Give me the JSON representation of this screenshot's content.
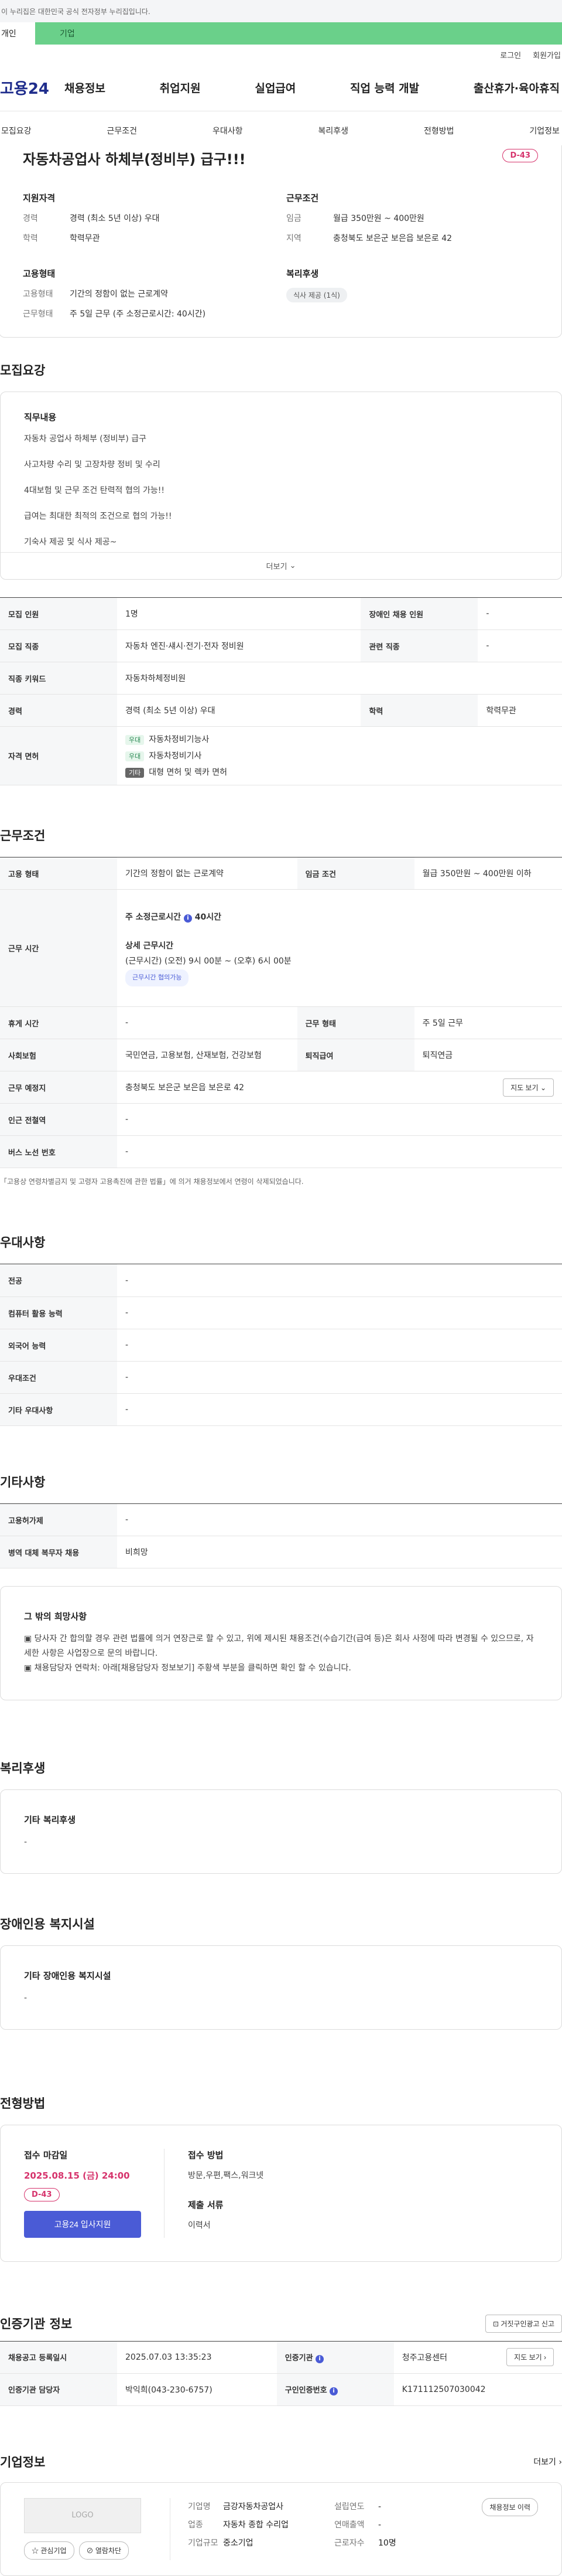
{
  "gov_banner": "이 누리집은 대한민국 공식 전자정부 누리집입니다.",
  "user_tabs": [
    "개인",
    "기업"
  ],
  "util_links": [
    "로그인",
    "회원가입"
  ],
  "logo": "고용24",
  "gnb": [
    "채용정보",
    "취업지원",
    "실업급여",
    "직업 능력 개발",
    "출산휴가·육아휴직"
  ],
  "subtabs": [
    "모집요강",
    "근무조건",
    "우대사항",
    "복리후생",
    "전형방법",
    "기업정보"
  ],
  "job": {
    "title": "자동차공업사 하체부(정비부) 급구!!!",
    "dday": "D-43",
    "qual_title": "지원자격",
    "qual": [
      [
        "경력",
        "경력 (최소 5년 이상) 우대"
      ],
      [
        "학력",
        "학력무관"
      ]
    ],
    "cond_title": "근무조건",
    "cond": [
      [
        "임금",
        "월급 350만원 ~ 400만원"
      ],
      [
        "지역",
        "충청북도 보은군 보은읍 보은로 42"
      ]
    ],
    "emp_title": "고용형태",
    "emp": [
      [
        "고용형태",
        "기간의 정함이 없는 근로계약"
      ],
      [
        "근무형태",
        "주 5일 근무 (주 소정근로시간: 40시간)"
      ]
    ],
    "welfare_title": "복리후생",
    "welfare_chip": "식사 제공 (1식)"
  },
  "recruit": {
    "title": "모집요강",
    "duty_title": "직무내용",
    "lines": [
      "자동차 공업사 하체부 (정비부) 급구",
      "사고차량 수리 및 고장차량 정비 및 수리",
      "4대보험 및 근무 조건 탄력적 협의 가능!!",
      "급여는 최대한 최적의 조건으로 협의 가능!!",
      "기숙사 제공 및 식사 제공~"
    ],
    "more": "더보기"
  },
  "recruit_table": {
    "headcount_k": "모집 인원",
    "headcount_v": "1명",
    "disabled_k": "장애인 채용 인원",
    "disabled_v": "-",
    "job_k": "모집 직종",
    "job_v": "자동차 엔진·섀시·전기·전자 정비원",
    "related_k": "관련 직종",
    "related_v": "-",
    "kw_k": "직종 키워드",
    "kw_v": "자동차하체정비원",
    "career_k": "경력",
    "career_v": "경력 (최소 5년 이상) 우대",
    "edu_k": "학력",
    "edu_v": "학력무관",
    "license_k": "자격 면허",
    "licenses": [
      {
        "badge": "우대",
        "name": "자동차정비기능사"
      },
      {
        "badge": "우대",
        "name": "자동차정비기사"
      },
      {
        "badge": "기타",
        "name": "대형 면허 및 렉카 면허"
      }
    ]
  },
  "work": {
    "title": "근무조건",
    "emptype_k": "고용 형태",
    "emptype_v": "기간의 정함이 없는 근로계약",
    "wage_k": "임금 조건",
    "wage_v": "월급 350만원 ~ 400만원 이하",
    "hours_k": "근무 시간",
    "hours_label": "주 소정근로시간",
    "hours_v": "40시간",
    "detail_title": "상세 근무시간",
    "detail_v": "(근무시간) (오전) 9시 00분 ~ (오후) 6시 00분",
    "detail_chip": "근무시간 협의가능",
    "rest_k": "휴게 시간",
    "rest_v": "-",
    "shift_k": "근무 형태",
    "shift_v": "주 5일 근무",
    "ins_k": "사회보험",
    "ins_v": "국민연금, 고용보험, 산재보험, 건강보험",
    "sev_k": "퇴직급여",
    "sev_v": "퇴직연금",
    "place_k": "근무 예정지",
    "place_v": "충청북도 보은군 보은읍 보은로 42",
    "map_btn": "지도 보기",
    "metro_k": "인근 전철역",
    "metro_v": "-",
    "bus_k": "버스 노선 번호",
    "bus_v": "-",
    "note": "「고용상 연령차별금지 및 고령자 고용촉진에 관한 법률」에 의거 채용정보에서 연령이 삭제되었습니다."
  },
  "pref": {
    "title": "우대사항",
    "rows": [
      [
        "전공",
        "-"
      ],
      [
        "컴퓨터 활용 능력",
        "-"
      ],
      [
        "외국어 능력",
        "-"
      ],
      [
        "우대조건",
        "-"
      ],
      [
        "기타 우대사항",
        "-"
      ]
    ]
  },
  "etc": {
    "title": "기타사항",
    "rows": [
      [
        "고용허가제",
        "-"
      ],
      [
        "병역 대체 복무자 채용",
        "비희망"
      ]
    ],
    "card_title": "그 밖의 희망사항",
    "card_lines": [
      "▣ 당사자 간 합의할 경우 관련 법률에 의거 연장근로 할 수 있고, 위에 제시된 채용조건(수습기간(급여 등)은 회사 사정에 따라 변경될 수 있으므로, 자세한 사항은 사업장으로 문의 바랍니다.",
      "▣ 채용담당자 연락처: 아래[채용담당자 정보보기] 주황색 부분을 클릭하면 확인 할 수 있습니다."
    ]
  },
  "welfare": {
    "title": "복리후생",
    "card_title": "기타 복리후생",
    "card_v": "-"
  },
  "disab": {
    "title": "장애인용 복지시설",
    "card_title": "기타 장애인용 복지시설",
    "card_v": "-"
  },
  "process": {
    "title": "전형방법",
    "deadline_k": "접수 마감일",
    "deadline_v": "2025.08.15 (금) 24:00",
    "dday": "D-43",
    "apply_btn": "고용24 입사지원",
    "method_k": "접수 방법",
    "method_v": "방문,우편,팩스,워크넷",
    "docs_k": "제출 서류",
    "docs_v": "이력서"
  },
  "agency": {
    "title": "인증기관 정보",
    "report_btn": "거짓구인광고 신고",
    "reg_k": "채용공고 등록일시",
    "reg_v": "2025.07.03 13:35:23",
    "org_k": "인증기관",
    "org_v": "청주고용센터",
    "map_btn": "지도 보기",
    "mgr_k": "인증기관 담당자",
    "mgr_v": "박익희(043-230-6757)",
    "num_k": "구인인증번호",
    "num_v": "K171112507030042"
  },
  "company": {
    "title": "기업정보",
    "more": "더보기",
    "logo": "LOGO",
    "fav_btn": "관심기업",
    "block_btn": "열람차단",
    "name_k": "기업명",
    "name_v": "금강자동차공업사",
    "industry_k": "업종",
    "industry_v": "자동차 종합 수리업",
    "size_k": "기업규모",
    "size_v": "중소기업",
    "founded_k": "설립연도",
    "founded_v": "-",
    "sales_k": "연매출액",
    "sales_v": "-",
    "staff_k": "근로자수",
    "staff_v": "10명",
    "history_btn": "채용정보 이력"
  }
}
